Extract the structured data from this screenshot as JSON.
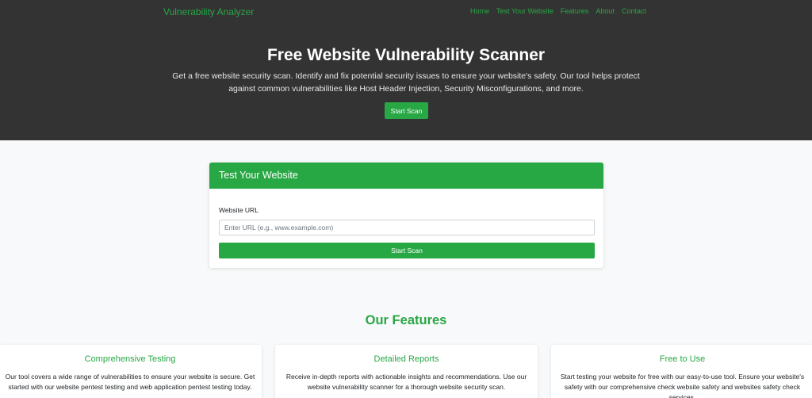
{
  "nav": {
    "brand": "Vulnerability Analyzer",
    "links": [
      "Home",
      "Test Your Website",
      "Features",
      "About",
      "Contact"
    ]
  },
  "hero": {
    "title": "Free Website Vulnerability Scanner",
    "description": "Get a free website security scan. Identify and fix potential security issues to ensure your website's safety. Our tool helps protect against common vulnerabilities like Host Header Injection, Security Misconfigurations, and more.",
    "button_label": "Start Scan"
  },
  "test_card": {
    "header": "Test Your Website",
    "url_label": "Website URL",
    "url_value": "",
    "url_placeholder": "Enter URL (e.g., www.example.com)",
    "button_label": "Start Scan"
  },
  "features": {
    "title": "Our Features",
    "items": [
      {
        "title": "Comprehensive Testing",
        "text": "Our tool covers a wide range of vulnerabilities to ensure your website is secure. Get started with our website pentest testing and web application pentest testing today."
      },
      {
        "title": "Detailed Reports",
        "text": "Receive in-depth reports with actionable insights and recommendations. Use our website vulnerability scanner for a thorough website security scan."
      },
      {
        "title": "Free to Use",
        "text": "Start testing your website for free with our easy-to-use tool. Ensure your website's safety with our comprehensive check website safety and websites safety check services."
      }
    ]
  },
  "colors": {
    "accent": "#28a745",
    "hero_bg": "#333333",
    "page_bg": "#f8f9fa"
  }
}
